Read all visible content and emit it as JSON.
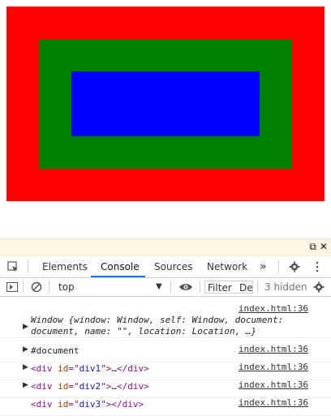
{
  "page": {
    "div1": {
      "color": "#ff0000"
    },
    "div2": {
      "color": "#008000"
    },
    "div3": {
      "color": "#0000ff"
    }
  },
  "devtools": {
    "tabs": [
      "Elements",
      "Console",
      "Sources",
      "Network"
    ],
    "more_tabs_label": "»",
    "console_bar": {
      "context": "top",
      "filter_placeholder": "Filter",
      "levels_truncated": "De",
      "hidden_count": "3 hidden"
    },
    "entries": [
      {
        "link": "index.html:36",
        "lines": [
          "Window {window: Window, self: Window, document:",
          "document, name: \"\", location: Location, …}"
        ]
      },
      {
        "link": "index.html:36",
        "text": "#document"
      },
      {
        "link": "index.html:36",
        "tag": "div",
        "id": "div1",
        "ellipsis": "…"
      },
      {
        "link": "index.html:36",
        "tag": "div",
        "id": "div2",
        "ellipsis": "…"
      },
      {
        "link": "index.html:36",
        "tag": "div",
        "id": "div3"
      }
    ]
  }
}
